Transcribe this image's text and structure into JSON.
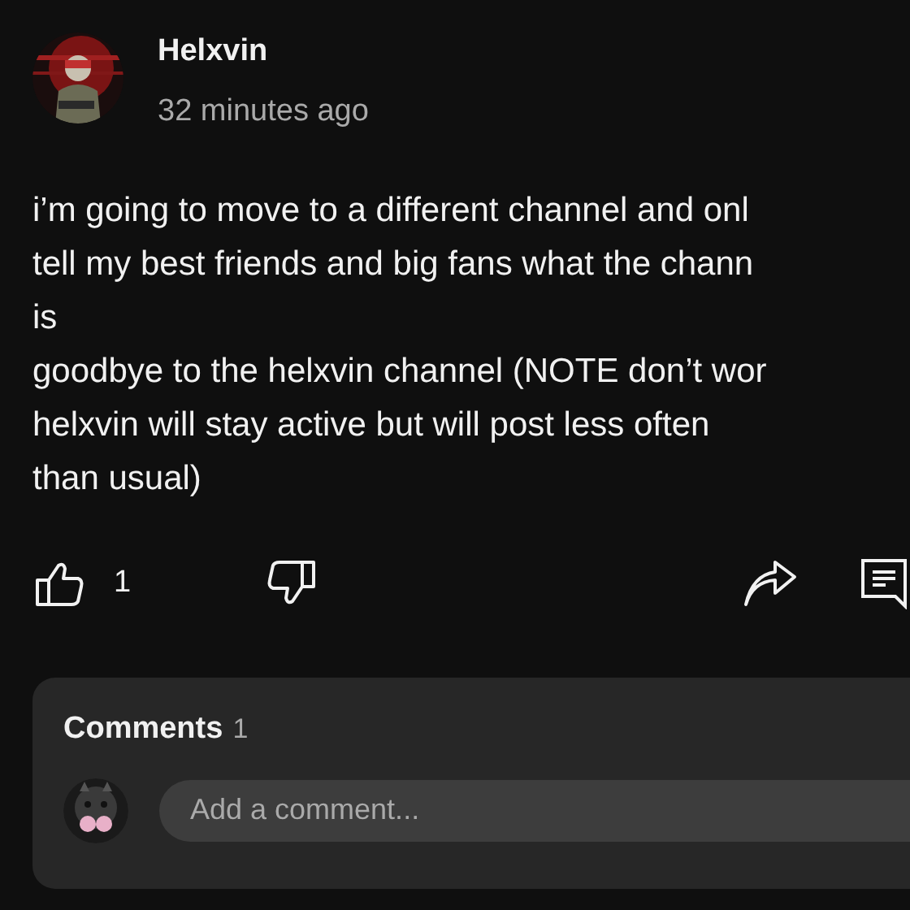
{
  "post": {
    "author": "Helxvin",
    "time": "32 minutes ago",
    "lines": [
      "i’m going to move to a different channel and onl",
      "tell my best friends and big fans what the chann",
      "is",
      "goodbye to the helxvin channel (NOTE don’t wor",
      "helxvin will stay active but will post less often",
      "than usual)"
    ],
    "likes": "1"
  },
  "comments": {
    "title": "Comments",
    "count": "1",
    "placeholder": "Add a comment..."
  }
}
